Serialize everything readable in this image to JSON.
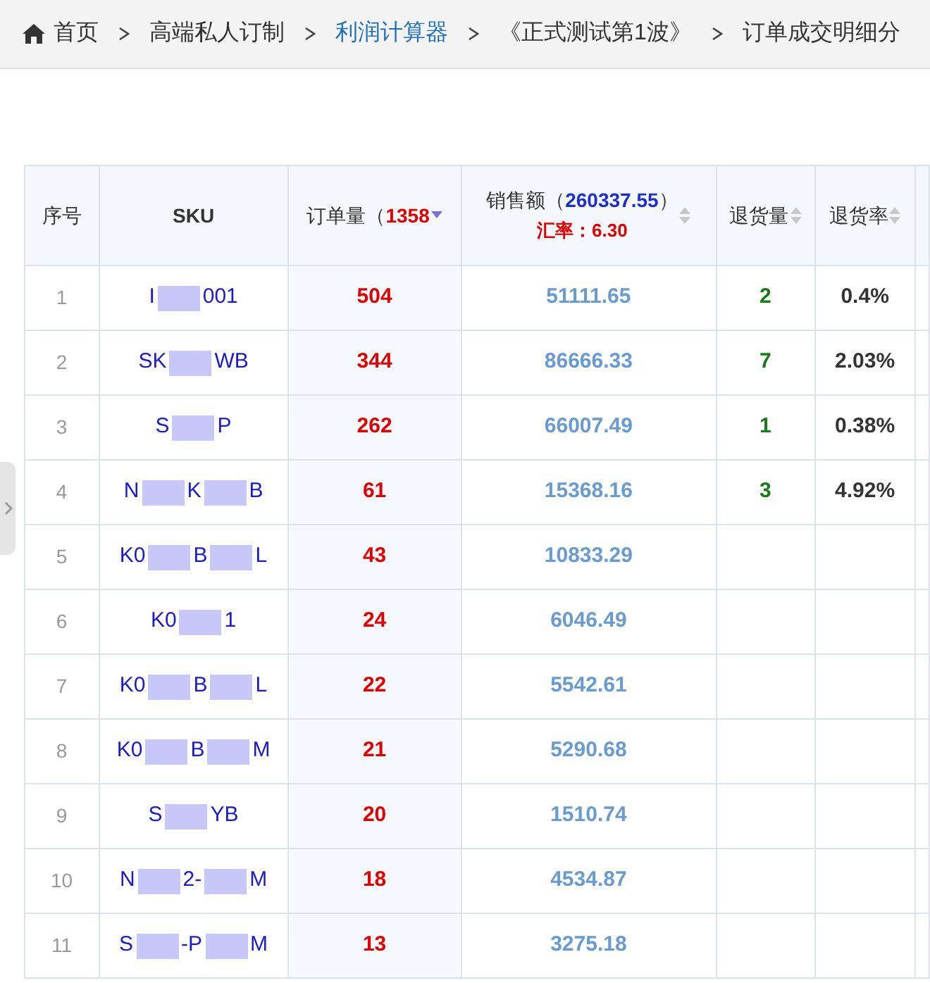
{
  "breadcrumb": [
    {
      "label": "首页",
      "kind": "home"
    },
    {
      "label": "高端私人订制",
      "kind": "plain"
    },
    {
      "label": "利润计算器",
      "kind": "link"
    },
    {
      "label": "《正式测试第1波》",
      "kind": "plain"
    },
    {
      "label": "订单成交明细分",
      "kind": "plain"
    }
  ],
  "table": {
    "columns": [
      {
        "label": "序号"
      },
      {
        "label": "SKU"
      },
      {
        "label": "订单量（",
        "total": "1358",
        "sorted": true
      },
      {
        "label": "销售额（",
        "total": "260337.55",
        "suffix": "）",
        "note": "汇率：6.30",
        "sorted": false
      },
      {
        "label": "退货量",
        "sorted": false
      },
      {
        "label": "退货率",
        "sorted": false
      }
    ],
    "rows": [
      {
        "index": "1",
        "sku": [
          "I",
          "001"
        ],
        "orders": "504",
        "sales": "51111.65",
        "returns": "2",
        "return_rate": "0.4%"
      },
      {
        "index": "2",
        "sku": [
          "SK",
          "WB"
        ],
        "orders": "344",
        "sales": "86666.33",
        "returns": "7",
        "return_rate": "2.03%"
      },
      {
        "index": "3",
        "sku": [
          "S",
          "P"
        ],
        "orders": "262",
        "sales": "66007.49",
        "returns": "1",
        "return_rate": "0.38%"
      },
      {
        "index": "4",
        "sku": [
          "N",
          "K",
          "B"
        ],
        "orders": "61",
        "sales": "15368.16",
        "returns": "3",
        "return_rate": "4.92%"
      },
      {
        "index": "5",
        "sku": [
          "K0",
          "B",
          "L"
        ],
        "orders": "43",
        "sales": "10833.29"
      },
      {
        "index": "6",
        "sku": [
          "K0",
          "1"
        ],
        "orders": "24",
        "sales": "6046.49"
      },
      {
        "index": "7",
        "sku": [
          "K0",
          "B",
          "L"
        ],
        "orders": "22",
        "sales": "5542.61"
      },
      {
        "index": "8",
        "sku": [
          "K0",
          "B",
          "M"
        ],
        "orders": "21",
        "sales": "5290.68"
      },
      {
        "index": "9",
        "sku": [
          "S",
          "YB"
        ],
        "orders": "20",
        "sales": "1510.74"
      },
      {
        "index": "10",
        "sku": [
          "N",
          "2-",
          "M"
        ],
        "orders": "18",
        "sales": "4534.87"
      },
      {
        "index": "11",
        "sku": [
          "S",
          "-P",
          "M"
        ],
        "orders": "13",
        "sales": "3275.18"
      }
    ]
  }
}
